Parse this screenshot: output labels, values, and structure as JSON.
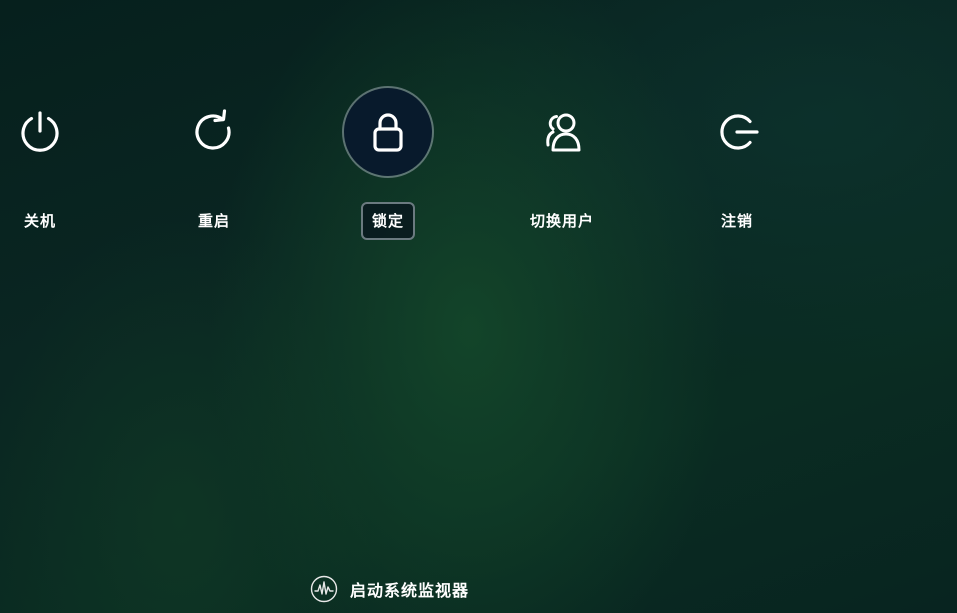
{
  "power_options": [
    {
      "label": "关机",
      "icon": "power-icon"
    },
    {
      "label": "重启",
      "icon": "restart-icon"
    },
    {
      "label": "锁定",
      "icon": "lock-icon",
      "selected": true
    },
    {
      "label": "切换用户",
      "icon": "switch-user-icon"
    },
    {
      "label": "注销",
      "icon": "logout-icon"
    }
  ],
  "system_monitor": {
    "label": "启动系统监视器",
    "icon": "system-monitor-icon"
  },
  "colors": {
    "background": "#0a2622",
    "selected_fill": "#081a2c",
    "text": "#ffffff"
  }
}
